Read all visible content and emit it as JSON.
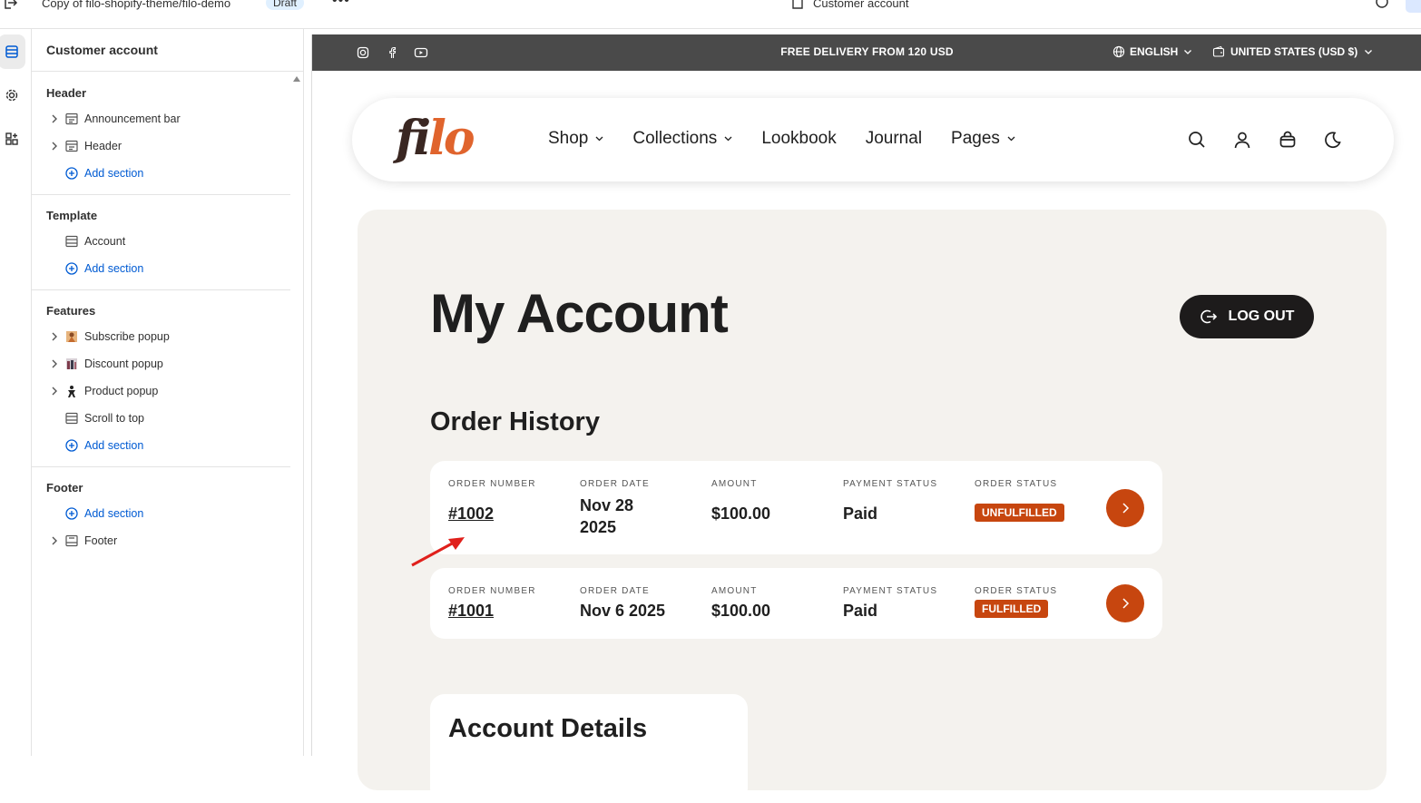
{
  "topbar": {
    "theme_name": "Copy of filo-shopify-theme/filo-demo",
    "draft_label": "Draft",
    "more_label": "•••",
    "page_name": "Customer account"
  },
  "sidebar": {
    "title": "Customer account",
    "groups": {
      "header": {
        "title": "Header",
        "items": [
          "Announcement bar",
          "Header"
        ],
        "add_label": "Add section"
      },
      "template": {
        "title": "Template",
        "items": [
          "Account"
        ],
        "add_label": "Add section"
      },
      "features": {
        "title": "Features",
        "items": [
          "Subscribe popup",
          "Discount popup",
          "Product popup",
          "Scroll to top"
        ],
        "add_label": "Add section"
      },
      "footer": {
        "title": "Footer",
        "add_label": "Add section",
        "items": [
          "Footer"
        ]
      }
    }
  },
  "store": {
    "announcement": "FREE DELIVERY FROM 120 USD",
    "language": "ENGLISH",
    "currency": "UNITED STATES (USD $)",
    "logo": {
      "part1": "fi",
      "part2": "lo"
    },
    "menu": [
      "Shop",
      "Collections",
      "Lookbook",
      "Journal",
      "Pages"
    ],
    "colors": {
      "accent": "#c7460f",
      "logo_dark": "#3a2722",
      "logo_orange": "#e0642d",
      "announce_bg": "#4a4a4a",
      "card_bg": "#f4f2ee"
    },
    "page_title": "My Account",
    "logout_label": "LOG OUT",
    "order_history_title": "Order History",
    "column_labels": {
      "number": "ORDER NUMBER",
      "date": "ORDER DATE",
      "amount": "AMOUNT",
      "payment": "PAYMENT STATUS",
      "status": "ORDER STATUS"
    },
    "orders": [
      {
        "number": "#1002",
        "date_line1": "Nov 28",
        "date_line2": "2025",
        "amount": "$100.00",
        "payment": "Paid",
        "status": "UNFULFILLED"
      },
      {
        "number": "#1001",
        "date_line1": "Nov 6 2025",
        "date_line2": "",
        "amount": "$100.00",
        "payment": "Paid",
        "status": "FULFILLED"
      }
    ],
    "account_details_title": "Account Details"
  }
}
